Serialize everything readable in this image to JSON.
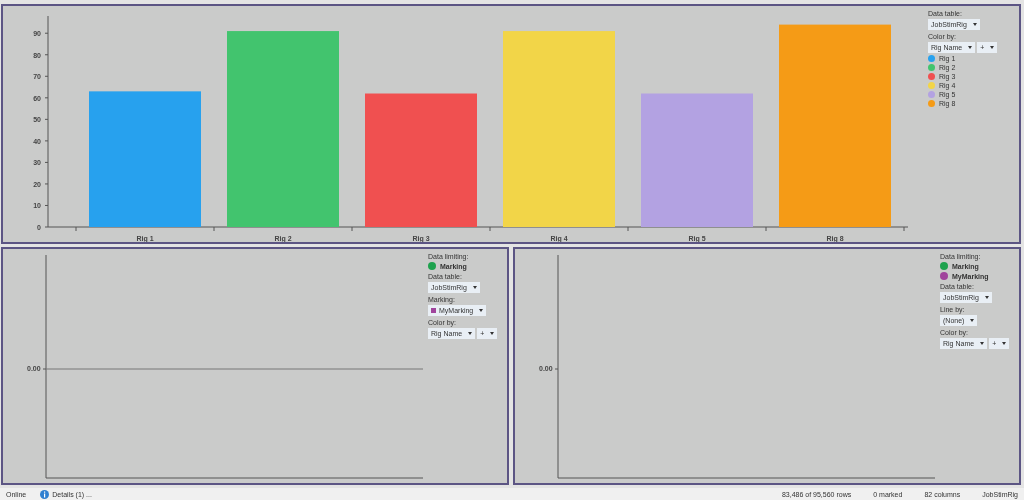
{
  "top_panel": {
    "chart_data": {
      "type": "bar",
      "categories": [
        "Rig 1",
        "Rig 2",
        "Rig 3",
        "Rig 4",
        "Rig 5",
        "Rig 8"
      ],
      "values": [
        63,
        91,
        62,
        91,
        62,
        94
      ],
      "ylim": [
        0,
        98
      ],
      "yticks": [
        0,
        10,
        20,
        30,
        40,
        50,
        60,
        70,
        80,
        90
      ]
    },
    "legend": {
      "controls": [
        {
          "kind": "dropdown",
          "label": "Data table:",
          "value": "JobStimRig"
        },
        {
          "kind": "color_by",
          "label": "Color by:",
          "value": "Rig Name",
          "extra": "+"
        }
      ],
      "items": [
        {
          "label": "Rig 1",
          "color": "#27a1ee"
        },
        {
          "label": "Rig 2",
          "color": "#42c46e"
        },
        {
          "label": "Rig 3",
          "color": "#f05050"
        },
        {
          "label": "Rig 4",
          "color": "#f2d548"
        },
        {
          "label": "Rig 5",
          "color": "#b3a2e2"
        },
        {
          "label": "Rig 8",
          "color": "#f59b16"
        }
      ]
    }
  },
  "bottom_panels": [
    {
      "y_tick": "0.00",
      "zero_line": true,
      "legend": {
        "limiting_label": "Data limiting:",
        "limiting": [
          {
            "label": "Marking",
            "color": "#1ea24e"
          }
        ],
        "controls": [
          {
            "kind": "dropdown",
            "label": "Data table:",
            "value": "JobStimRig"
          },
          {
            "kind": "marking",
            "label": "Marking:",
            "value": "MyMarking",
            "color": "#a0449c"
          },
          {
            "kind": "color_by",
            "label": "Color by:",
            "value": "Rig Name",
            "extra": "+"
          }
        ]
      }
    },
    {
      "y_tick": "0.00",
      "zero_line": false,
      "legend": {
        "limiting_label": "Data limiting:",
        "limiting": [
          {
            "label": "Marking",
            "color": "#1ea24e"
          },
          {
            "label": "MyMarking",
            "color": "#a0449c"
          }
        ],
        "controls": [
          {
            "kind": "dropdown",
            "label": "Data table:",
            "value": "JobStimRig"
          },
          {
            "kind": "dropdown",
            "label": "Line by:",
            "value": "(None)"
          },
          {
            "kind": "color_by",
            "label": "Color by:",
            "value": "Rig Name",
            "extra": "+"
          }
        ]
      }
    }
  ],
  "status_bar": {
    "status": "Online",
    "details": "Details (1) ...",
    "rows": "83,486 of 95,560 rows",
    "marked": "0 marked",
    "columns": "82 columns",
    "table": "JobStimRig"
  }
}
